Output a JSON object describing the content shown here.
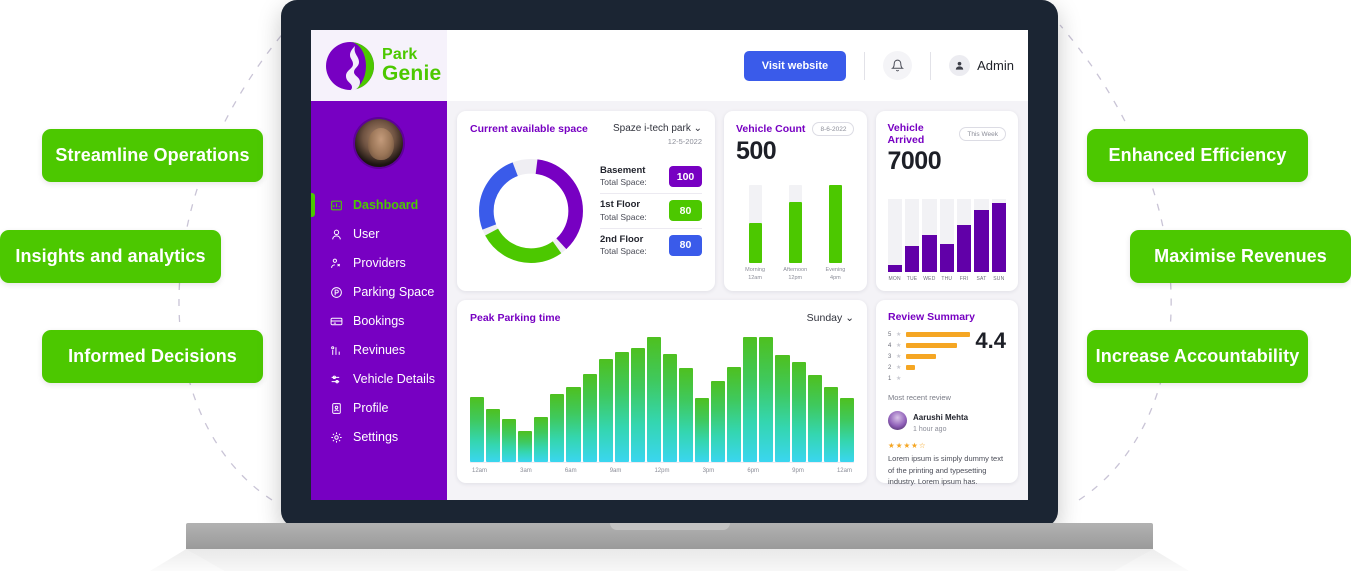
{
  "promo": {
    "left": [
      {
        "label": "Streamline Operations"
      },
      {
        "label": "Insights and analytics"
      },
      {
        "label": "Informed Decisions"
      }
    ],
    "right": [
      {
        "label": "Enhanced Efficiency"
      },
      {
        "label": "Maximise Revenues"
      },
      {
        "label": "Increase Accountability"
      }
    ],
    "accent_green": "#4cc800"
  },
  "header": {
    "logo_top": "Park",
    "logo_bottom": "Genie",
    "visit_button": "Visit website",
    "bell_icon": "bell-icon",
    "admin_label": "Admin",
    "admin_icon": "user-avatar-icon",
    "visit_button_color": "#3a5bea"
  },
  "sidebar": {
    "brand_color": "#7700c2",
    "active_color": "#4cc800",
    "items": [
      {
        "label": "Dashboard",
        "icon": "dashboard-icon",
        "active": true
      },
      {
        "label": "User",
        "icon": "user-icon",
        "active": false
      },
      {
        "label": "Providers",
        "icon": "providers-icon",
        "active": false
      },
      {
        "label": "Parking Space",
        "icon": "parking-space-icon",
        "active": false
      },
      {
        "label": "Bookings",
        "icon": "bookings-icon",
        "active": false
      },
      {
        "label": "Revinues",
        "icon": "revenues-icon",
        "active": false
      },
      {
        "label": "Vehicle Details",
        "icon": "vehicle-details-icon",
        "active": false
      },
      {
        "label": "Profile",
        "icon": "profile-icon",
        "active": false
      },
      {
        "label": "Settings",
        "icon": "settings-icon",
        "active": false
      }
    ]
  },
  "available_space": {
    "title": "Current available space",
    "location": "Spaze i-tech park",
    "date": "12-5-2022",
    "rows": [
      {
        "name": "Basement",
        "sub": "Total Space:",
        "value": "100",
        "color": "#7700c2"
      },
      {
        "name": "1st Floor",
        "sub": "Total Space:",
        "value": "80",
        "color": "#4cc800"
      },
      {
        "name": "2nd Floor",
        "sub": "Total Space:",
        "value": "80",
        "color": "#3a5bea"
      }
    ]
  },
  "vehicle_count": {
    "title": "Vehicle Count",
    "badge": "8-6-2022",
    "value": "500"
  },
  "vehicle_arrived": {
    "title": "Vehicle Arrived",
    "badge": "This Week",
    "value": "7000"
  },
  "peak": {
    "title": "Peak Parking time",
    "day": "Sunday"
  },
  "review": {
    "title": "Review Summary",
    "score": "4.4",
    "recent_label": "Most recent review",
    "reviewer": "Aarushi Mehta",
    "time": "1 hour ago",
    "stars": "★★★★☆",
    "text": "Lorem ipsum is simply dummy text of the printing and typesetting industry. Lorem ipsum has.",
    "breakdown": [
      {
        "stars": "5",
        "pct": 100
      },
      {
        "stars": "4",
        "pct": 79
      },
      {
        "stars": "3",
        "pct": 47
      },
      {
        "stars": "2",
        "pct": 14
      },
      {
        "stars": "1",
        "pct": 0
      }
    ]
  },
  "chart_data": [
    {
      "type": "pie",
      "title": "Current available space",
      "labels": [
        "Basement",
        "1st Floor",
        "2nd Floor"
      ],
      "values": [
        100,
        80,
        80
      ],
      "colors": [
        "#7700c2",
        "#4cc800",
        "#3a5bea"
      ],
      "legend": "right"
    },
    {
      "type": "bar",
      "title": "Vehicle Count",
      "categories": [
        "Morning 12am",
        "Afternoon 12pm",
        "Evening 4pm"
      ],
      "values": [
        52,
        78,
        100
      ],
      "ylim": [
        0,
        100
      ],
      "color": "#4cc800",
      "track_color": "#f2f2f5",
      "total": 500
    },
    {
      "type": "bar",
      "title": "Vehicle Arrived",
      "categories": [
        "MON",
        "TUE",
        "WED",
        "THU",
        "FRI",
        "SAT",
        "SUN"
      ],
      "values": [
        9,
        36,
        51,
        39,
        64,
        85,
        95
      ],
      "ylim": [
        0,
        100
      ],
      "color": "#6100a8",
      "track_color": "#f2f2f5",
      "total": 7000
    },
    {
      "type": "bar",
      "title": "Peak Parking time",
      "xlabel": "",
      "ylabel": "",
      "subtitle": "Sunday",
      "tick_labels": [
        "12am",
        "3am",
        "6am",
        "9am",
        "12pm",
        "3pm",
        "6pm",
        "9pm",
        "12am"
      ],
      "categories": [
        "12am",
        "1am",
        "2am",
        "3am",
        "4am",
        "5am",
        "6am",
        "7am",
        "8am",
        "9am",
        "10am",
        "11am",
        "12pm",
        "1pm",
        "2pm",
        "3pm",
        "4pm",
        "5pm",
        "6pm",
        "7pm",
        "8pm",
        "9pm",
        "10pm",
        "11pm"
      ],
      "values": [
        50,
        41,
        33,
        24,
        35,
        52,
        58,
        68,
        79,
        85,
        88,
        96,
        83,
        72,
        49,
        62,
        73,
        96,
        96,
        82,
        77,
        67,
        58,
        49
      ],
      "ylim": [
        0,
        100
      ]
    },
    {
      "type": "bar",
      "title": "Review Summary",
      "categories": [
        "5",
        "4",
        "3",
        "2",
        "1"
      ],
      "values": [
        100,
        79,
        47,
        14,
        0
      ],
      "ylim": [
        0,
        100
      ],
      "color": "#f5a623",
      "average": 4.4
    }
  ]
}
